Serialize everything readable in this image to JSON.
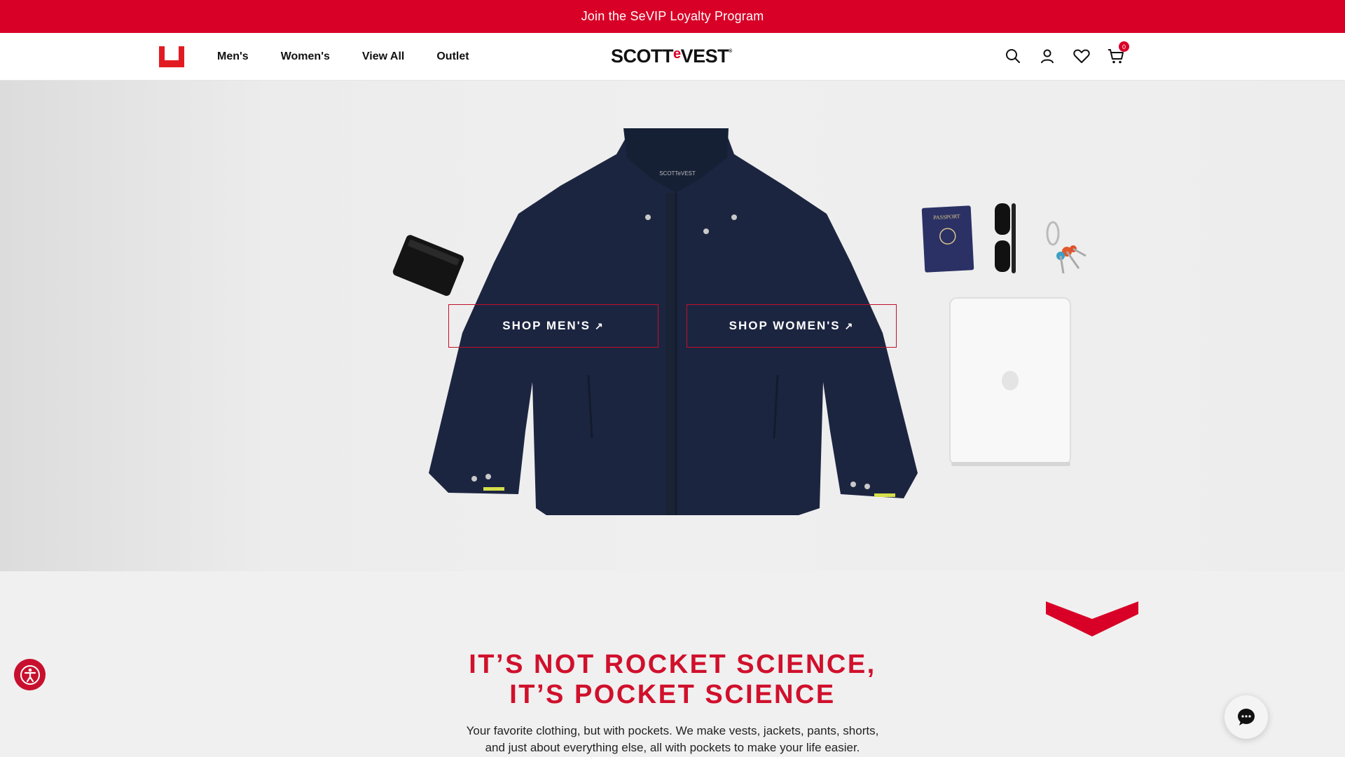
{
  "promo": {
    "text": "Join the SeVIP Loyalty Program"
  },
  "nav": {
    "items": [
      {
        "label": "Men's"
      },
      {
        "label": "Women's"
      },
      {
        "label": "View All"
      },
      {
        "label": "Outlet"
      }
    ]
  },
  "brand": {
    "logo_prefix": "SCOTT",
    "logo_e": "e",
    "logo_suffix": "VEST",
    "logo_mark": "®"
  },
  "header": {
    "cart_count": "0"
  },
  "hero": {
    "shop_mens": "SHOP MEN'S",
    "shop_womens": "SHOP WOMEN'S",
    "arrow": "↗",
    "passport_text": "PASSPORT",
    "jacket_label": "SCOTTeVEST"
  },
  "tagline": {
    "headline_line1": "IT’S NOT ROCKET SCIENCE,",
    "headline_line2": "IT’S POCKET SCIENCE",
    "body_line1": "Your favorite clothing, but with pockets. We make vests, jackets, pants, shorts,",
    "body_line2": "and just about everything else, all with pockets to make your life easier."
  },
  "colors": {
    "brand_red": "#d80027",
    "navy": "#1c2540"
  },
  "icons": [
    "brand-u-icon",
    "search-icon",
    "account-icon",
    "heart-icon",
    "cart-icon",
    "accessibility-icon",
    "chat-icon",
    "chevron-down-icon"
  ]
}
